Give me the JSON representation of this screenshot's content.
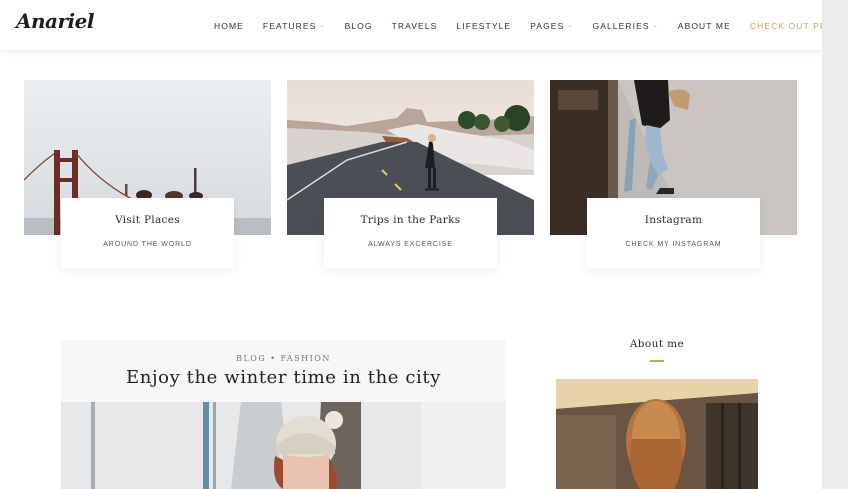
{
  "site": {
    "logo": "Anariel"
  },
  "nav": {
    "items": [
      {
        "label": "HOME",
        "dropdown": false
      },
      {
        "label": "FEATURES",
        "dropdown": true
      },
      {
        "label": "BLOG",
        "dropdown": false
      },
      {
        "label": "TRAVELS",
        "dropdown": false
      },
      {
        "label": "LIFESTYLE",
        "dropdown": false
      },
      {
        "label": "PAGES",
        "dropdown": true
      },
      {
        "label": "GALLERIES",
        "dropdown": true
      },
      {
        "label": "ABOUT ME",
        "dropdown": false
      }
    ],
    "premium": "CHECK OUT PREMIUM VERSION"
  },
  "featured": [
    {
      "title": "Visit Places",
      "subtitle": "AROUND THE WORLD"
    },
    {
      "title": "Trips in the Parks",
      "subtitle": "ALWAYS EXCERCISE"
    },
    {
      "title": "Instagram",
      "subtitle": "CHECK MY INSTAGRAM"
    }
  ],
  "post": {
    "category": "BLOG • FASHION",
    "title": "Enjoy the winter time in the city"
  },
  "sidebar": {
    "widget_title": "About me"
  },
  "colors": {
    "accent": "#c9a45c",
    "text": "#222222",
    "header_bg": "#ffffff"
  },
  "icons": {
    "dropdown": "chevron-down-icon"
  }
}
